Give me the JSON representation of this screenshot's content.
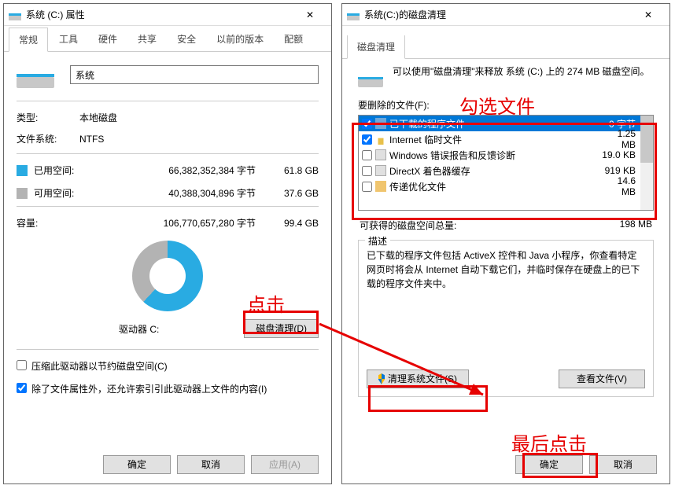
{
  "win1": {
    "title": "系统 (C:) 属性",
    "tabs": [
      "常规",
      "工具",
      "硬件",
      "共享",
      "安全",
      "以前的版本",
      "配额"
    ],
    "active_tab": 0,
    "name_value": "系统",
    "type_label": "类型:",
    "type_value": "本地磁盘",
    "fs_label": "文件系统:",
    "fs_value": "NTFS",
    "used_label": "已用空间:",
    "used_bytes": "66,382,352,384 字节",
    "used_gb": "61.8 GB",
    "free_label": "可用空间:",
    "free_bytes": "40,388,304,896 字节",
    "free_gb": "37.6 GB",
    "cap_label": "容量:",
    "cap_bytes": "106,770,657,280 字节",
    "cap_gb": "99.4 GB",
    "drive_letter": "驱动器 C:",
    "disk_cleanup_btn": "磁盘清理(D)",
    "compress_cb": "压缩此驱动器以节约磁盘空间(C)",
    "index_cb": "除了文件属性外，还允许索引引此驱动器上文件的内容(I)",
    "ok_btn": "确定",
    "cancel_btn": "取消",
    "apply_btn": "应用(A)"
  },
  "win2": {
    "title": "系统(C:)的磁盘清理",
    "tab": "磁盘清理",
    "intro": "可以使用\"磁盘清理\"来释放 系统 (C:) 上的 274 MB 磁盘空间。",
    "filelist_label": "要删除的文件(F):",
    "items": [
      {
        "checked": true,
        "iconClass": "ficon",
        "label": "已下载的程序文件",
        "size": "0 字节",
        "selected": true
      },
      {
        "checked": true,
        "iconClass": "ficon lock",
        "label": "Internet 临时文件",
        "size": "1.25 MB"
      },
      {
        "checked": false,
        "iconClass": "ficon page",
        "label": "Windows 错误报告和反馈诊断",
        "size": "19.0 KB"
      },
      {
        "checked": false,
        "iconClass": "ficon page",
        "label": "DirectX 着色器缓存",
        "size": "919 KB"
      },
      {
        "checked": false,
        "iconClass": "ficon folder",
        "label": "传递优化文件",
        "size": "14.6 MB"
      }
    ],
    "reclaim_label": "可获得的磁盘空间总量:",
    "reclaim_size": "198 MB",
    "desc_title": "描述",
    "desc_text": "已下载的程序文件包括 ActiveX 控件和 Java 小程序，你查看特定网页时将会从 Internet 自动下载它们，并临时保存在硬盘上的已下载的程序文件夹中。",
    "clean_sys_btn": "清理系统文件(S)",
    "view_files_btn": "查看文件(V)",
    "ok_btn": "确定",
    "cancel_btn": "取消"
  },
  "annotations": {
    "click": "点击",
    "select_files": "勾选文件",
    "final_click": "最后点击"
  }
}
